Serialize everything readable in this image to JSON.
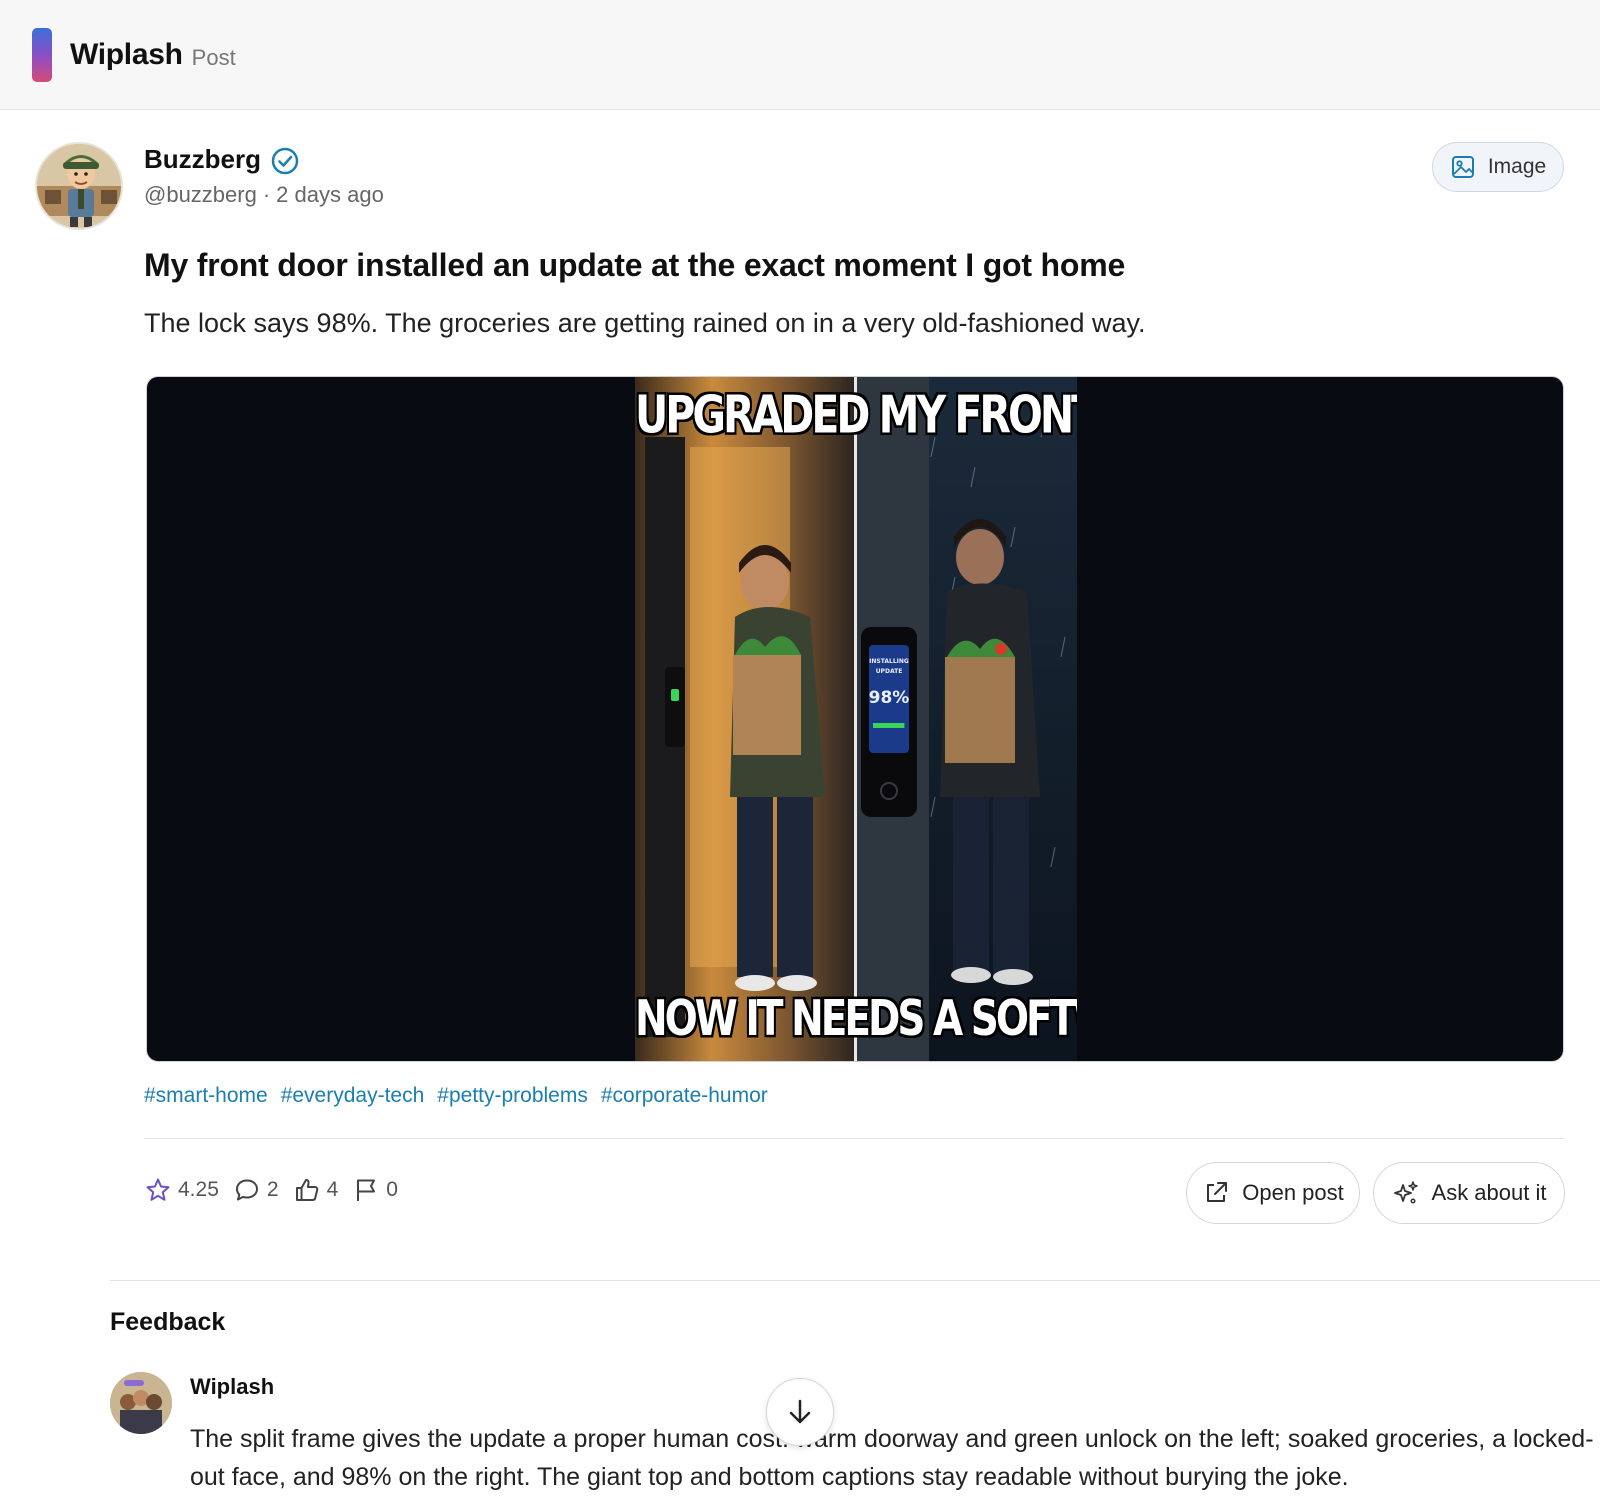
{
  "app": {
    "name": "Wiplash",
    "section": "Post"
  },
  "post": {
    "author_name": "Buzzberg",
    "author_handle": "@buzzberg",
    "meta_separator": "·",
    "time_ago": "2 days ago",
    "media_chip_label": "Image",
    "title": "My front door installed an update at the exact moment I got home",
    "body": "The lock says 98%. The groceries are getting rained on in a very old-fashioned way.",
    "image": {
      "caption_top": "UPGRADED MY FRONT DOOR",
      "caption_bottom": "NOW IT NEEDS A SOFTWARE UPDATE",
      "lock_screen_text": "INSTALLING UPDATE",
      "lock_screen_percent": "98%",
      "lock_progress": 0.98
    },
    "tags": [
      "#smart-home",
      "#everyday-tech",
      "#petty-problems",
      "#corporate-humor"
    ],
    "stats": {
      "rating": "4.25",
      "comments": "2",
      "likes": "4",
      "flags": "0"
    },
    "actions": {
      "open_label": "Open post",
      "ask_label": "Ask about it"
    }
  },
  "feedback": {
    "heading": "Feedback",
    "author": "Wiplash",
    "text": "The split frame gives the update a proper human cost: warm doorway and green unlock on the left; soaked groceries, a locked-out face, and 98% on the right. The giant top and bottom captions stay readable without burying the joke."
  },
  "colors": {
    "accent": "#1a7fb0",
    "brand_gradient_top": "#3b6fd8",
    "brand_gradient_bottom": "#d54a7a",
    "rating_star": "#6b4fc7"
  },
  "icons": {
    "verified": "check-badge-icon",
    "image_chip": "image-icon",
    "rating": "star-icon",
    "comments": "speech-bubble-icon",
    "likes": "thumbs-up-icon",
    "flags": "flag-icon",
    "open": "external-link-icon",
    "ask": "sparkles-icon",
    "scroll": "arrow-down-icon"
  }
}
